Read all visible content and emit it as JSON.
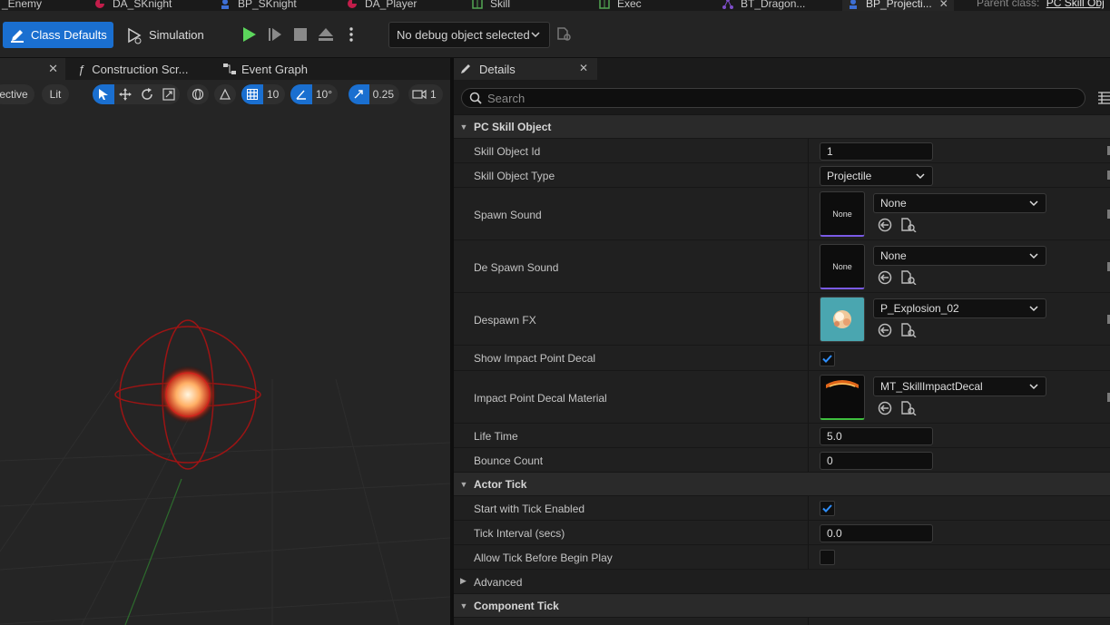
{
  "tabs": [
    {
      "label": "_Enemy",
      "icon": "asset-icon",
      "color": "#c21d4a"
    },
    {
      "label": "DA_SKnight",
      "icon": "data-asset-icon",
      "color": "#c21d4a"
    },
    {
      "label": "BP_SKnight",
      "icon": "blueprint-actor-icon",
      "color": "#3d6fd6"
    },
    {
      "label": "DA_Player",
      "icon": "data-asset-icon",
      "color": "#c21d4a"
    },
    {
      "label": "Skill",
      "icon": "data-table-icon",
      "color": "#53a653"
    },
    {
      "label": "Exec",
      "icon": "data-table-icon",
      "color": "#53a653"
    },
    {
      "label": "BT_Dragon...",
      "icon": "behavior-tree-icon",
      "color": "#7e4ec9"
    },
    {
      "label": "BP_Projecti...",
      "icon": "blueprint-actor-icon",
      "color": "#3d6fd6"
    }
  ],
  "parent_class": {
    "label": "Parent class:",
    "value": "PC Skill Obj"
  },
  "toolbar": {
    "class_defaults": "Class Defaults",
    "simulation": "Simulation",
    "debug_object": "No debug object selected"
  },
  "editor_tabs": {
    "construction": "Construction Scr...",
    "event_graph": "Event Graph"
  },
  "viewport": {
    "perspective": "ective",
    "lit": "Lit",
    "grid_snap": "10",
    "rotation_snap": "10°",
    "scale_snap": "0.25",
    "camera_speed": "1"
  },
  "details": {
    "tab_label": "Details",
    "search_placeholder": "Search",
    "categories": {
      "pc_skill_object": "PC Skill Object",
      "actor_tick": "Actor Tick",
      "advanced": "Advanced",
      "component_tick": "Component Tick"
    },
    "props": {
      "skill_object_id": {
        "label": "Skill Object Id",
        "value": "1"
      },
      "skill_object_type": {
        "label": "Skill Object Type",
        "value": "Projectile"
      },
      "spawn_sound": {
        "label": "Spawn Sound",
        "value": "None",
        "thumb": "None"
      },
      "despawn_sound": {
        "label": "De Spawn Sound",
        "value": "None",
        "thumb": "None"
      },
      "despawn_fx": {
        "label": "Despawn FX",
        "value": "P_Explosion_02"
      },
      "show_impact_decal": {
        "label": "Show Impact Point Decal",
        "checked": true
      },
      "impact_decal_material": {
        "label": "Impact Point Decal Material",
        "value": "MT_SkillImpactDecal"
      },
      "life_time": {
        "label": "Life Time",
        "value": "5.0"
      },
      "bounce_count": {
        "label": "Bounce Count",
        "value": "0"
      },
      "start_tick": {
        "label": "Start with Tick Enabled",
        "checked": true
      },
      "tick_interval": {
        "label": "Tick Interval (secs)",
        "value": "0.0"
      },
      "allow_tick": {
        "label": "Allow Tick Before Begin Play",
        "checked": false
      }
    }
  },
  "colors": {
    "accent": "#1a6fd0",
    "sound_asset": "#7a5ae6",
    "material_asset": "#3fbf3f",
    "play_green": "#5cd65c"
  }
}
